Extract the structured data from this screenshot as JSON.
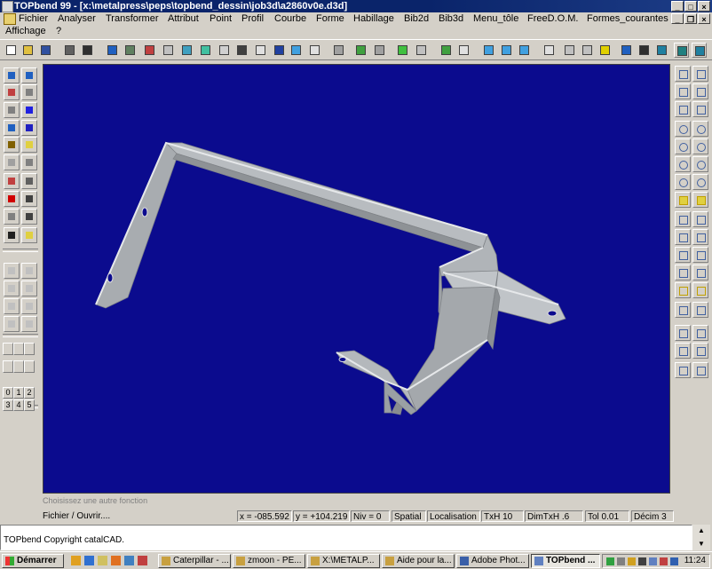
{
  "window": {
    "title": "TOPbend 99  - [x:\\metalpress\\peps\\topbend_dessin\\job3d\\a2860v0e.d3d]",
    "controls": [
      "_",
      "□",
      "×"
    ]
  },
  "menu": {
    "row1": [
      "Fichier",
      "Analyser",
      "Transformer",
      "Attribut",
      "Point",
      "Profil",
      "Courbe",
      "Forme",
      "Habillage",
      "Bib2d",
      "Bib3d",
      "Menu_tôle",
      "FreeD.O.M.",
      "Formes_courantes"
    ],
    "row2": [
      "Affichage",
      "?"
    ]
  },
  "left_panel": {
    "numpad": [
      "0",
      "1",
      "2",
      "3",
      "4",
      "5"
    ]
  },
  "hint": "Choisissez une autre fonction",
  "status": {
    "command": "Fichier / Ouvrir....",
    "x": "x = -085.592",
    "y": "y = +104.219",
    "niv": "Niv = 0",
    "spatial": "Spatial",
    "localisation": "Localisation",
    "txh": "TxH 10",
    "dimtxh": "DimTxH .6",
    "tol": "Tol  0.01",
    "decim": "Décim 3"
  },
  "message": "TOPbend Copyright catalCAD.",
  "taskbar": {
    "start": "Démarrer",
    "tasks": [
      "Caterpillar - ...",
      "zmoon - PE...",
      "X:\\METALP...",
      "Aide pour la...",
      "Adobe Phot...",
      "TOPbend ..."
    ],
    "clock": "11:24"
  },
  "colors": {
    "viewport_bg": "#0b0b8e",
    "titlebar_bg": "#0a246a",
    "chrome": "#d4d0c8",
    "part_fill": "#b8bcc0",
    "part_edge": "#e6e8ea"
  }
}
